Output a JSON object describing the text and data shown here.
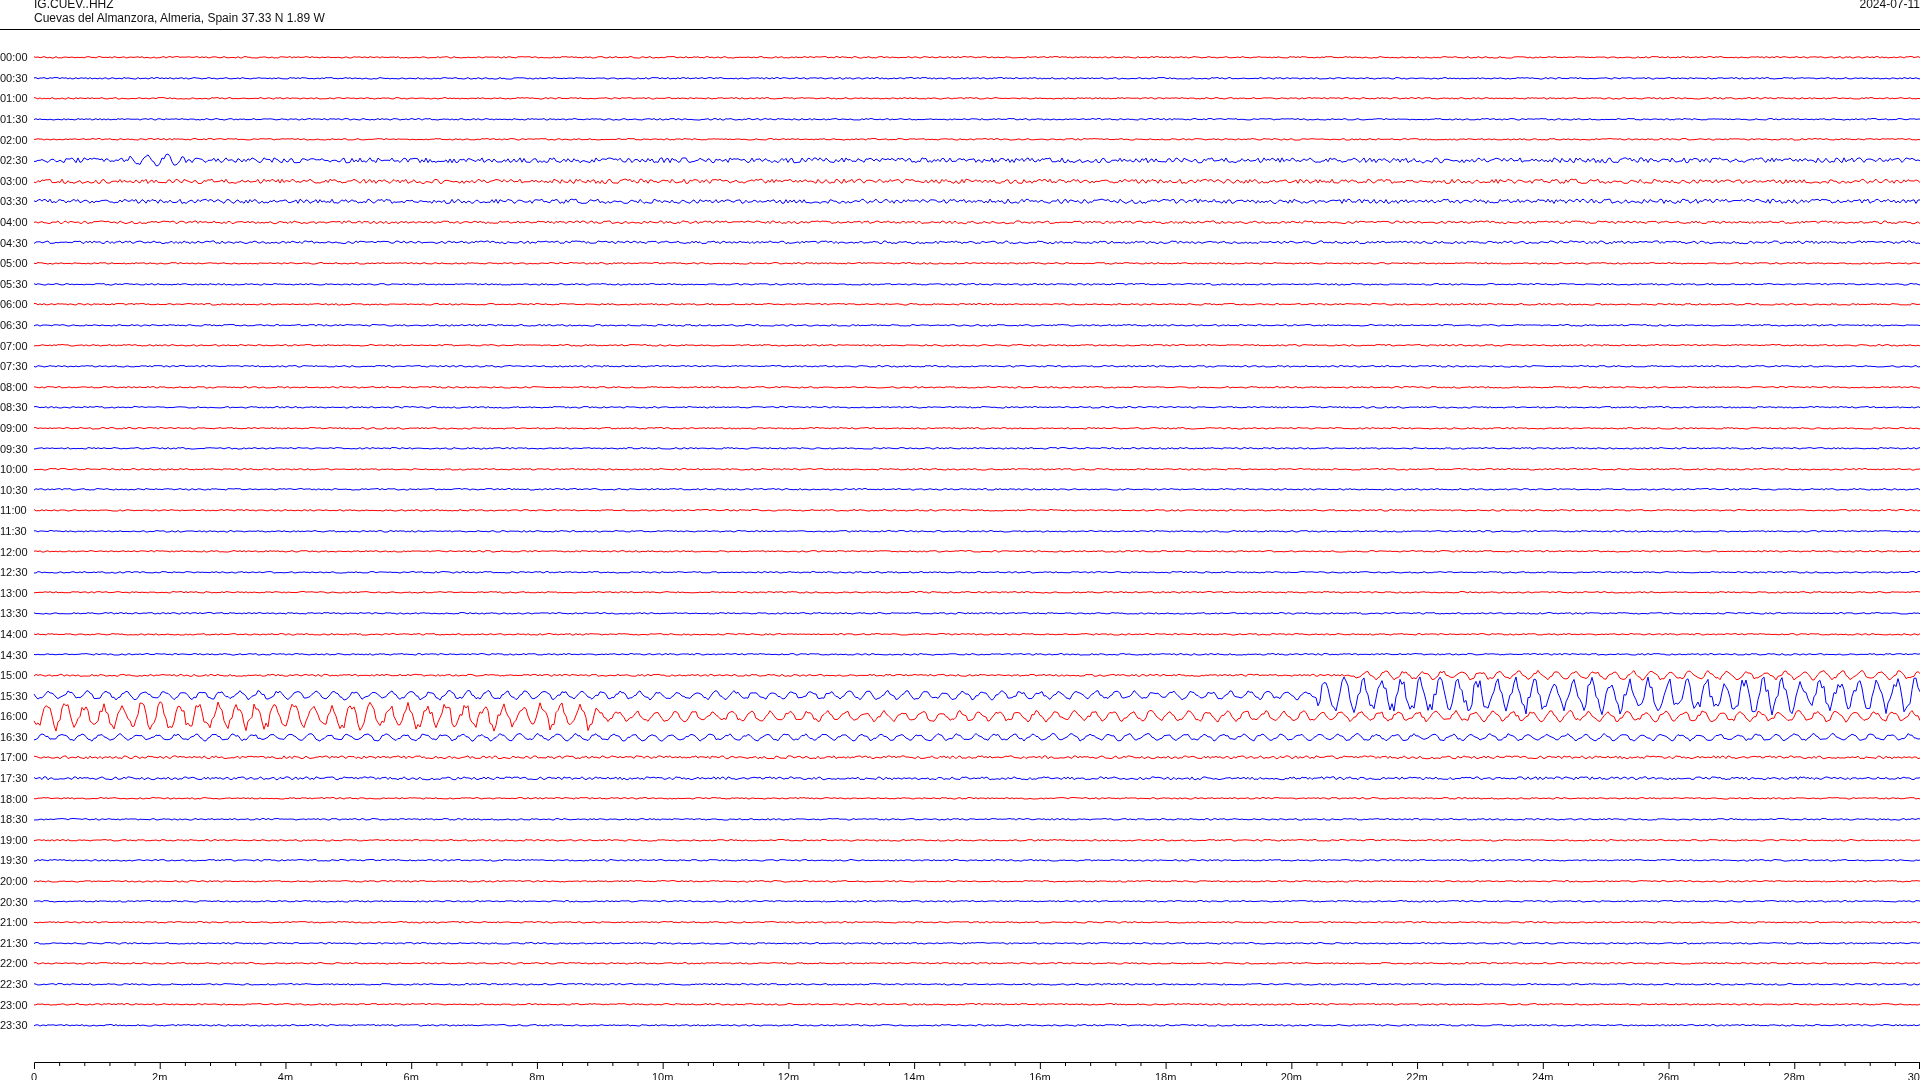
{
  "header": {
    "station": "IG.CUEV..HHZ",
    "location": "Cuevas del Almanzora, Almeria, Spain  37.33 N 1.89 W",
    "date": "2024-07-11"
  },
  "rows": [
    {
      "time": "00:00",
      "color": "#ff0000"
    },
    {
      "time": "00:30",
      "color": "#0000ff"
    },
    {
      "time": "01:00",
      "color": "#ff0000"
    },
    {
      "time": "01:30",
      "color": "#0000ff"
    },
    {
      "time": "02:00",
      "color": "#ff0000"
    },
    {
      "time": "02:30",
      "color": "#0000ff"
    },
    {
      "time": "03:00",
      "color": "#ff0000"
    },
    {
      "time": "03:30",
      "color": "#0000ff"
    },
    {
      "time": "04:00",
      "color": "#ff0000"
    },
    {
      "time": "04:30",
      "color": "#0000ff"
    },
    {
      "time": "05:00",
      "color": "#ff0000"
    },
    {
      "time": "05:30",
      "color": "#0000ff"
    },
    {
      "time": "06:00",
      "color": "#ff0000"
    },
    {
      "time": "06:30",
      "color": "#0000ff"
    },
    {
      "time": "07:00",
      "color": "#ff0000"
    },
    {
      "time": "07:30",
      "color": "#0000ff"
    },
    {
      "time": "08:00",
      "color": "#ff0000"
    },
    {
      "time": "08:30",
      "color": "#0000ff"
    },
    {
      "time": "09:00",
      "color": "#ff0000"
    },
    {
      "time": "09:30",
      "color": "#0000ff"
    },
    {
      "time": "10:00",
      "color": "#ff0000"
    },
    {
      "time": "10:30",
      "color": "#0000ff"
    },
    {
      "time": "11:00",
      "color": "#ff0000"
    },
    {
      "time": "11:30",
      "color": "#0000ff"
    },
    {
      "time": "12:00",
      "color": "#ff0000"
    },
    {
      "time": "12:30",
      "color": "#0000ff"
    },
    {
      "time": "13:00",
      "color": "#ff0000"
    },
    {
      "time": "13:30",
      "color": "#0000ff"
    },
    {
      "time": "14:00",
      "color": "#ff0000"
    },
    {
      "time": "14:30",
      "color": "#0000ff"
    },
    {
      "time": "15:00",
      "color": "#ff0000"
    },
    {
      "time": "15:30",
      "color": "#0000ff"
    },
    {
      "time": "16:00",
      "color": "#ff0000"
    },
    {
      "time": "16:30",
      "color": "#0000ff"
    },
    {
      "time": "17:00",
      "color": "#ff0000"
    },
    {
      "time": "17:30",
      "color": "#0000ff"
    },
    {
      "time": "18:00",
      "color": "#ff0000"
    },
    {
      "time": "18:30",
      "color": "#0000ff"
    },
    {
      "time": "19:00",
      "color": "#ff0000"
    },
    {
      "time": "19:30",
      "color": "#0000ff"
    },
    {
      "time": "20:00",
      "color": "#ff0000"
    },
    {
      "time": "20:30",
      "color": "#0000ff"
    },
    {
      "time": "21:00",
      "color": "#ff0000"
    },
    {
      "time": "21:30",
      "color": "#0000ff"
    },
    {
      "time": "22:00",
      "color": "#ff0000"
    },
    {
      "time": "22:30",
      "color": "#0000ff"
    },
    {
      "time": "23:00",
      "color": "#ff0000"
    },
    {
      "time": "23:30",
      "color": "#0000ff"
    }
  ],
  "x_axis": {
    "labels": [
      "0",
      "2m",
      "4m",
      "6m",
      "8m",
      "10m",
      "12m",
      "14m",
      "16m",
      "18m",
      "20m",
      "22m",
      "24m",
      "26m",
      "28m",
      "30"
    ]
  }
}
